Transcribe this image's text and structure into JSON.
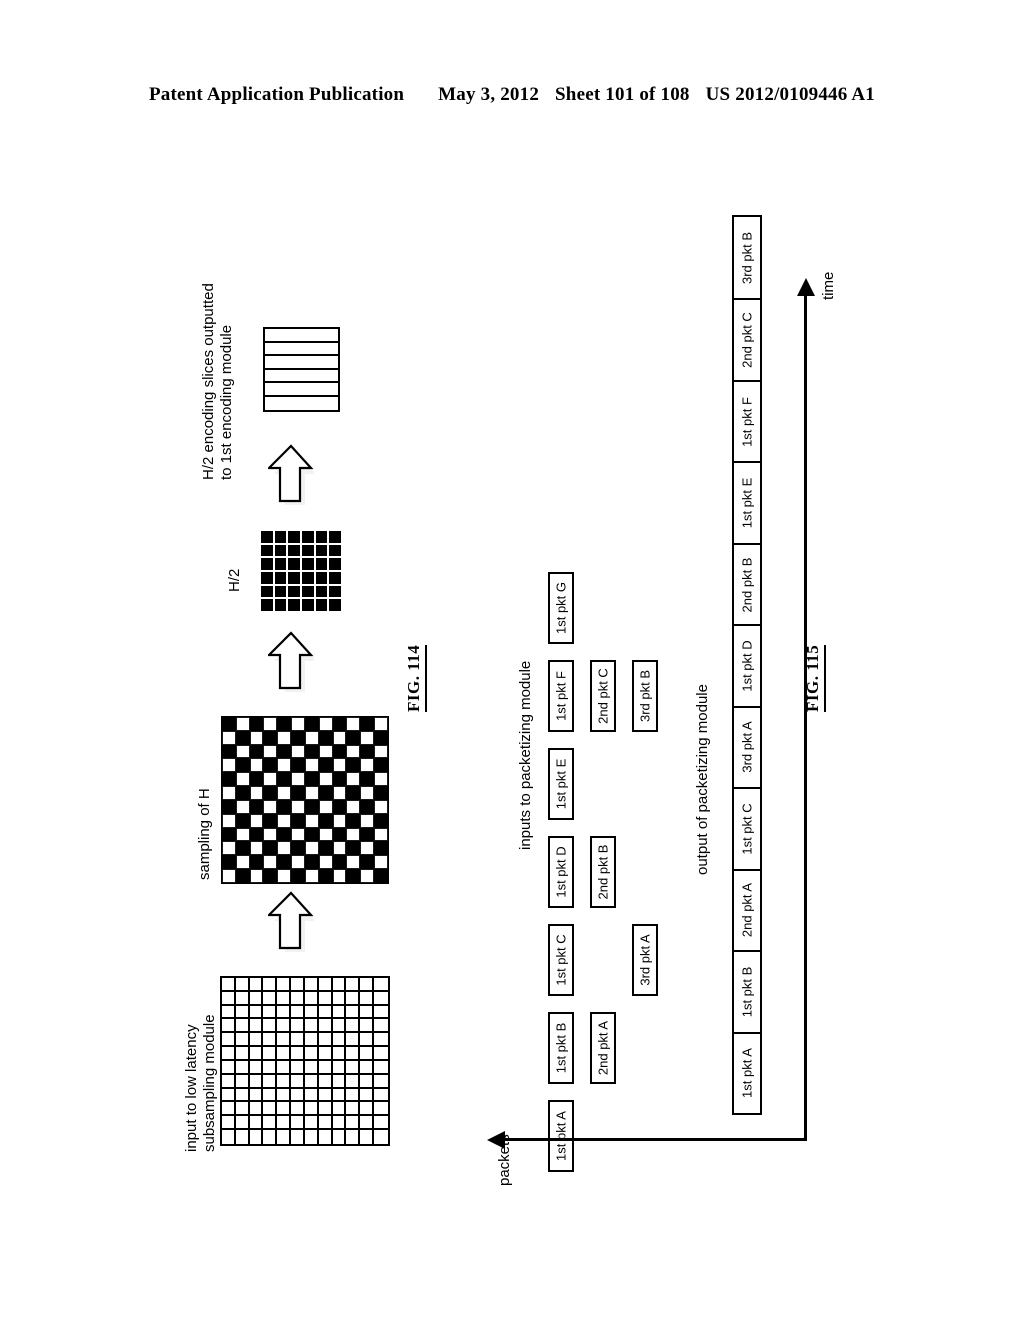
{
  "header": {
    "publication": "Patent Application Publication",
    "date": "May 3, 2012",
    "sheet": "Sheet 101 of 108",
    "patent_number": "US 2012/0109446 A1"
  },
  "fig114": {
    "label": "FIG. 114",
    "input_label_line1": "input to low latency",
    "input_label_line2": "subsampling module",
    "sampling_label": "sampling of H",
    "half_label": "H/2",
    "output_label_line1": "H/2 encoding slices outputted",
    "output_label_line2": "to 1st encoding module",
    "input_grid": {
      "rows": 12,
      "cols": 12
    },
    "checkerboard": {
      "rows": 12,
      "cols": 12
    },
    "half_grid": {
      "rows": 6,
      "cols": 6
    },
    "slices": {
      "count": 6
    },
    "arrow_icon": "up-block-arrow"
  },
  "fig115": {
    "label": "FIG. 115",
    "inputs_title": "inputs to packetizing module",
    "output_title": "output of packetizing module",
    "time_axis_label": "time",
    "packets_axis_label": "packets",
    "input_columns": [
      {
        "first": "1st pkt A",
        "second": "",
        "third": ""
      },
      {
        "first": "1st pkt B",
        "second": "2nd pkt A",
        "third": ""
      },
      {
        "first": "1st pkt C",
        "second": "",
        "third": "3rd pkt A"
      },
      {
        "first": "1st pkt D",
        "second": "2nd pkt B",
        "third": ""
      },
      {
        "first": "1st pkt E",
        "second": "",
        "third": ""
      },
      {
        "first": "1st pkt F",
        "second": "2nd pkt C",
        "third": "3rd pkt B"
      },
      {
        "first": "1st pkt G",
        "second": "",
        "third": ""
      }
    ],
    "output_sequence": [
      "1st pkt A",
      "1st pkt B",
      "2nd pkt A",
      "1st pkt C",
      "3rd pkt A",
      "1st pkt D",
      "2nd pkt B",
      "1st pkt E",
      "1st pkt F",
      "2nd pkt C",
      "3rd pkt B"
    ]
  },
  "colors": {
    "ink": "#000000",
    "paper": "#ffffff",
    "shadow": "#c9c9c9"
  }
}
